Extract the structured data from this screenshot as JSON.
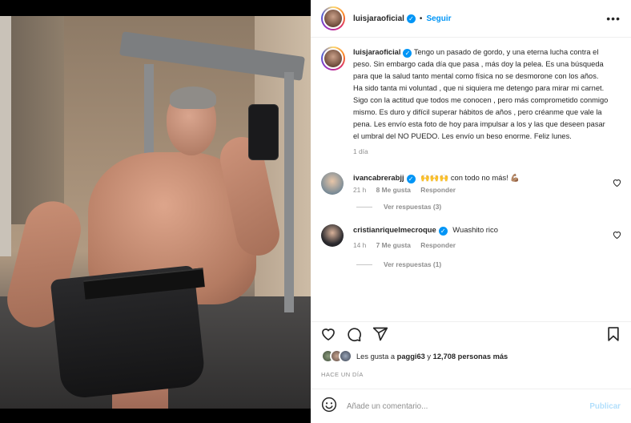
{
  "header": {
    "username": "luisjaraoficial",
    "separator": "•",
    "follow_label": "Seguir",
    "more_label": "•••"
  },
  "caption": {
    "username": "luisjaraoficial",
    "text": "Tengo un pasado de gordo, y una eterna lucha contra el peso. Sin embargo cada día que pasa , más doy la pelea. Es una búsqueda para que la salud tanto mental como física no se desmorone con los años. Ha sido tanta mi voluntad , que ni siquiera me detengo para mirar mi carnet. Sigo con la actitud que todos me conocen , pero más comprometido conmigo mismo. Es duro y difícil superar hábitos de años , pero créanme que vale la pena. Les envío esta foto de hoy para impulsar a los y las que deseen pasar el umbral del NO PUEDO. Les envío un beso enorme. Feliz lunes.",
    "time": "1 día"
  },
  "comments": [
    {
      "username": "ivancabrerabjj",
      "emoji": "🙌🙌🙌",
      "text": "con todo no más!",
      "trailing_emoji": "💪🏽",
      "time": "21 h",
      "likes": "8 Me gusta",
      "reply_label": "Responder",
      "view_replies": "Ver respuestas (3)"
    },
    {
      "username": "cristianriquelmecroque",
      "text": "Wuashito rico",
      "time": "14 h",
      "likes": "7 Me gusta",
      "reply_label": "Responder",
      "view_replies": "Ver respuestas (1)"
    }
  ],
  "likes": {
    "prefix": "Les gusta a",
    "user": "paggi63",
    "middle": "y",
    "count": "12,708 personas más"
  },
  "posted_when": "HACE UN DÍA",
  "compose": {
    "placeholder": "Añade un comentario...",
    "publish_label": "Publicar"
  },
  "colors": {
    "accent": "#0095f6",
    "publish_disabled": "#b2dffc",
    "muted": "#8e8e8e"
  },
  "icons": [
    "more-icon",
    "verified-icon",
    "heart-icon",
    "comment-icon",
    "share-icon",
    "bookmark-icon",
    "emoji-icon"
  ]
}
